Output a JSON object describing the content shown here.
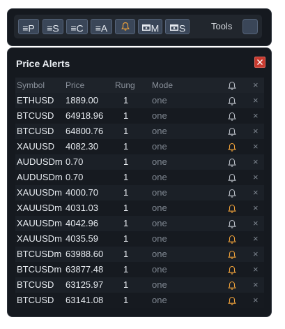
{
  "toolbar": {
    "buttons": [
      {
        "glyph": "≡",
        "label": "P",
        "icon": "list-icon"
      },
      {
        "glyph": "≡",
        "label": "S",
        "icon": "list-icon"
      },
      {
        "glyph": "≡",
        "label": "C",
        "icon": "list-icon"
      },
      {
        "glyph": "≡",
        "label": "A",
        "icon": "list-icon"
      },
      {
        "glyph": "",
        "label": "",
        "icon": "bell-icon"
      },
      {
        "glyph": "",
        "label": "M",
        "icon": "screen-icon"
      },
      {
        "glyph": "",
        "label": "S",
        "icon": "screen-icon"
      }
    ],
    "tools_label": "Tools"
  },
  "panel": {
    "title": "Price Alerts",
    "headers": {
      "symbol": "Symbol",
      "price": "Price",
      "rung": "Rung",
      "mode": "Mode"
    },
    "rows": [
      {
        "symbol": "ETHUSD",
        "price": "1889.00",
        "rung": "1",
        "mode": "one",
        "bell": "gray"
      },
      {
        "symbol": "BTCUSD",
        "price": "64918.96",
        "rung": "1",
        "mode": "one",
        "bell": "gray"
      },
      {
        "symbol": "BTCUSD",
        "price": "64800.76",
        "rung": "1",
        "mode": "one",
        "bell": "gray"
      },
      {
        "symbol": "XAUUSD",
        "price": "4082.30",
        "rung": "1",
        "mode": "one",
        "bell": "orange"
      },
      {
        "symbol": "AUDUSDm",
        "price": "0.70",
        "rung": "1",
        "mode": "one",
        "bell": "gray"
      },
      {
        "symbol": "AUDUSDm",
        "price": "0.70",
        "rung": "1",
        "mode": "one",
        "bell": "gray"
      },
      {
        "symbol": "XAUUSDm",
        "price": "4000.70",
        "rung": "1",
        "mode": "one",
        "bell": "gray"
      },
      {
        "symbol": "XAUUSDm",
        "price": "4031.03",
        "rung": "1",
        "mode": "one",
        "bell": "orange"
      },
      {
        "symbol": "XAUUSDm",
        "price": "4042.96",
        "rung": "1",
        "mode": "one",
        "bell": "gray"
      },
      {
        "symbol": "XAUUSDm",
        "price": "4035.59",
        "rung": "1",
        "mode": "one",
        "bell": "orange"
      },
      {
        "symbol": "BTCUSDm",
        "price": "63988.60",
        "rung": "1",
        "mode": "one",
        "bell": "orange"
      },
      {
        "symbol": "BTCUSDm",
        "price": "63877.48",
        "rung": "1",
        "mode": "one",
        "bell": "orange"
      },
      {
        "symbol": "BTCUSD",
        "price": "63125.97",
        "rung": "1",
        "mode": "one",
        "bell": "orange"
      },
      {
        "symbol": "BTCUSD",
        "price": "63141.08",
        "rung": "1",
        "mode": "one",
        "bell": "orange"
      }
    ],
    "delete_glyph": "×"
  },
  "colors": {
    "bell_orange": "#f0a23a",
    "bell_gray": "#b9bec6",
    "close_red": "#c83a2f",
    "button_bg": "#3a4658"
  }
}
